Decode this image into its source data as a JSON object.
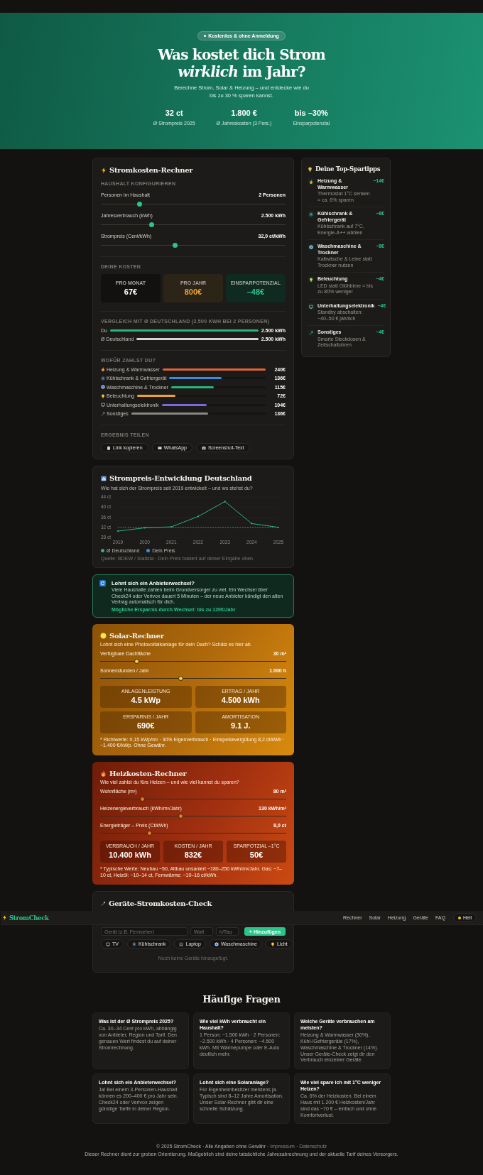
{
  "hero": {
    "badge": "Kostenlos & ohne Anmeldung",
    "title_line1": "Was kostet dich Strom",
    "title_line2": "*wirklich* im Jahr?",
    "subtitle": "Berechne Strom, Solar & Heizung – und entdecke wie du bis zu 30 % sparen kannst.",
    "stats": [
      {
        "value": "32 ct",
        "label": "Ø Strompreis 2025"
      },
      {
        "value": "1.800 €",
        "label": "Ø Jahreskosten (3 Pers.)"
      },
      {
        "value": "bis –30%",
        "label": "Einsparpotenzial"
      }
    ]
  },
  "calculator": {
    "title": "Stromkosten-Rechner",
    "section_label": "HAUSHALT KONFIGURIEREN",
    "sliders": [
      {
        "label": "Personen im Haushalt",
        "value": "2 Personen",
        "level": 0.2
      },
      {
        "label": "Jahresverbrauch (kWh)",
        "value": "2.500 kWh",
        "level": 0.27
      },
      {
        "label": "Strompreis (Cent/kWh)",
        "value": "32,0 ct/kWh",
        "level": 0.4
      }
    ],
    "costs_label": "DEINE KOSTEN",
    "costs": [
      {
        "label": "PRO MONAT",
        "value": "67€",
        "kind": "neutral"
      },
      {
        "label": "PRO JAHR",
        "value": "800€",
        "kind": "year"
      },
      {
        "label": "EINSPARPOTENZIAL",
        "value": "–48€",
        "kind": "saving"
      }
    ],
    "compare_label": "VERGLEICH MIT Ø DEUTSCHLAND (2.500 KWH BEI 2 PERSONEN)",
    "compare": [
      {
        "label": "Du",
        "value": "2.500 kWh",
        "level": 1,
        "color": "#2bb37f"
      },
      {
        "label": "Ø Deutschland",
        "value": "2.500 kWh",
        "level": 1,
        "color": "#d4d4d2"
      }
    ],
    "breakdown_label": "WOFÜR ZAHLST DU?",
    "breakdown": [
      {
        "kind": "heating",
        "label": "Heizung & Warmwasser",
        "value": "240€",
        "level": 1,
        "color": "#e0643a"
      },
      {
        "kind": "fridge",
        "label": "Kühlschrank & Gefriergerät",
        "value": "136€",
        "level": 0.54,
        "color": "#3b8be0"
      },
      {
        "kind": "washer",
        "label": "Waschmaschine & Trockner",
        "value": "115€",
        "level": 0.45,
        "color": "#2bb37f"
      },
      {
        "kind": "lighting",
        "label": "Beleuchtung",
        "value": "72€",
        "level": 0.3,
        "color": "#e8a33a"
      },
      {
        "kind": "electronics",
        "label": "Unterhaltungselektronik",
        "value": "104€",
        "level": 0.43,
        "color": "#7a6ae0"
      },
      {
        "kind": "other",
        "label": "Sonstiges",
        "value": "136€",
        "level": 0.57,
        "color": "#8a8883"
      }
    ],
    "share_label": "ERGEBNIS TEILEN",
    "share": [
      {
        "kind": "copy",
        "label": "Link kopieren"
      },
      {
        "kind": "whatsapp",
        "label": "WhatsApp"
      },
      {
        "kind": "screenshot",
        "label": "Screenshot-Text"
      }
    ]
  },
  "tips": {
    "title": "Deine Top-Spartipps",
    "items": [
      {
        "kind": "heating",
        "title": "Heizung & Warmwasser",
        "text": "Thermostat 1°C senken = ca. 6% sparen",
        "saving": "−14€"
      },
      {
        "kind": "fridge",
        "title": "Kühlschrank & Gefriergerät",
        "text": "Kühlschrank auf 7°C, Energie-A++ wählen",
        "saving": "−8€"
      },
      {
        "kind": "washer",
        "title": "Waschmaschine & Trockner",
        "text": "Kaltwäsche & Leine statt Trockner nutzen",
        "saving": "−8€"
      },
      {
        "kind": "lighting",
        "title": "Beleuchtung",
        "text": "LED statt Glühbirne = bis zu 80% weniger",
        "saving": "−4€"
      },
      {
        "kind": "electronics",
        "title": "Unterhaltungselektronik",
        "text": "Standby abschalten: ~40–50 € jährlich",
        "saving": "−4€"
      },
      {
        "kind": "other",
        "title": "Sonstiges",
        "text": "Smarte Steckdosen & Zeitschaltuhren",
        "saving": "−4€"
      }
    ]
  },
  "price_chart": {
    "title": "Strompreis-Entwicklung Deutschland",
    "subtitle": "Wie hat sich der Strompreis seit 2019 entwickelt – und wo stehst du?",
    "chart_data": {
      "type": "line",
      "categories": [
        "2019",
        "2020",
        "2021",
        "2022",
        "2023",
        "2024",
        "2025"
      ],
      "series": [
        {
          "name": "Ø Deutschland",
          "color": "#2bb37f",
          "values": [
            30.5,
            31.8,
            32.2,
            36.3,
            42.2,
            33.5,
            32.0
          ]
        },
        {
          "name": "Dein Preis",
          "color": "#3b8be0",
          "line_style": "dashed",
          "values": [
            32,
            32,
            32,
            32,
            32,
            32,
            32
          ]
        }
      ],
      "ylim": [
        28,
        44
      ],
      "yticks": [
        {
          "value": 28,
          "label": "28 ct"
        },
        {
          "value": 32,
          "label": "32 ct"
        },
        {
          "value": 36,
          "label": "36 ct"
        },
        {
          "value": 40,
          "label": "40 ct"
        },
        {
          "value": 44,
          "label": "44 ct"
        }
      ]
    },
    "source": "Quelle: BDEW / Statista · Dein Preis basiert auf deiner Eingabe oben."
  },
  "provider_switch": {
    "title": "Lohnt sich ein Anbieterwechsel?",
    "text": "Viele Haushalte zahlen beim Grundversorger zu viel. Ein Wechsel über Check24 oder Verivox dauert 5 Minuten – der neue Anbieter kündigt den alten Vertrag automatisch für dich.",
    "highlight": "Mögliche Ersparnis durch Wechsel: bis zu 120€/Jahr"
  },
  "solar": {
    "kind": "solar",
    "title": "Solar-Rechner",
    "subtitle": "Lohnt sich eine Photovoltaikanlage für dein Dach? Schätz es hier ab.",
    "sliders": [
      {
        "label": "Verfügbare Dachfläche",
        "value": "30 m²",
        "level": 0.19
      },
      {
        "label": "Sonnenstunden / Jahr",
        "value": "1.000 h",
        "level": 0.43
      }
    ],
    "tiles": [
      {
        "label": "ANLAGENLEISTUNG",
        "value": "4.5 kWp"
      },
      {
        "label": "ERTRAG / JAHR",
        "value": "4.500 kWh"
      },
      {
        "label": "ERSPARNIS / JAHR",
        "value": "690€"
      },
      {
        "label": "AMORTISATION",
        "value": "9.1 J."
      }
    ],
    "note": "* Richtwerte: 0,15 kWp/m² · 30% Eigenverbrauch · Einspeisevergütung 8,2 ct/kWh · ~1.400 €/kWp. Ohne Gewähr."
  },
  "heating": {
    "kind": "heating",
    "title": "Heizkosten-Rechner",
    "subtitle": "Wie viel zahlst du fürs Heizen – und wie viel kannst du sparen?",
    "sliders": [
      {
        "label": "Wohnfläche (m²)",
        "value": "80 m²",
        "level": 0.22
      },
      {
        "label": "Heizenergieverbrauch (kWh/m²/Jahr)",
        "value": "130 kWh/m²",
        "level": 0.43
      },
      {
        "label": "Energieträger – Preis (Ct/kWh)",
        "value": "8,0 ct",
        "level": 0.26
      }
    ],
    "tiles": [
      {
        "label": "VERBRAUCH / JAHR",
        "value": "10.400 kWh"
      },
      {
        "label": "KOSTEN / JAHR",
        "value": "832€"
      },
      {
        "label": "SPARPOTZIAL –1°C",
        "value": "50€"
      }
    ],
    "note": "* Typische Werte: Neubau ~50, Altbau unsaniert ~180–250 kWh/m²/Jahr. Gas: ~7–10 ct, Heizöl: ~10–14 ct, Fernwärme: ~10–16 ct/kWh."
  },
  "devices": {
    "title": "Geräte-Stromkosten-Check",
    "fields": [
      {
        "placeholder": "Gerät (z.B. Fernseher)"
      },
      {
        "placeholder": "Watt"
      },
      {
        "placeholder": "h/Tag"
      }
    ],
    "add_button": "+ Hinzufügen",
    "presets": [
      {
        "kind": "electronics",
        "label": "TV"
      },
      {
        "kind": "fridge",
        "label": "Kühlschrank"
      },
      {
        "kind": "laptop",
        "label": "Laptop"
      },
      {
        "kind": "washer",
        "label": "Waschmaschine"
      },
      {
        "kind": "lighting",
        "label": "Licht"
      }
    ],
    "empty": "Noch keine Geräte hinzugefügt."
  },
  "nav": {
    "logo": "StromCheck",
    "links": [
      "Rechner",
      "Solar",
      "Heizung",
      "Geräte",
      "FAQ"
    ],
    "theme_button": "Hell"
  },
  "faq": {
    "title": "Häufige Fragen",
    "items": [
      {
        "q": "Was ist der Ø Strompreis 2025?",
        "a": "Ca. 30–34 Cent pro kWh, abhängig von Anbieter, Region und Tarif. Den genauen Wert findest du auf deiner Stromrechnung."
      },
      {
        "q": "Wie viel kWh verbraucht ein Haushalt?",
        "a": "1 Person: ~1.500 kWh · 2 Personen: ~2.500 kWh · 4 Personen: ~4.500 kWh. Mit Wärmepumpe oder E-Auto deutlich mehr."
      },
      {
        "q": "Welche Geräte verbrauchen am meisten?",
        "a": "Heizung & Warmwasser (30%), Kühl-/Gefriergeräte (17%), Waschmaschine & Trockner (14%). Unser Geräte-Check zeigt dir den Verbrauch einzelner Geräte."
      },
      {
        "q": "Lohnt sich ein Anbieterwechsel?",
        "a": "Ja! Bei einem 3-Personen-Haushalt können es 200–400 € pro Jahr sein. Check24 oder Verivox zeigen günstige Tarife in deiner Region."
      },
      {
        "q": "Lohnt sich eine Solaranlage?",
        "a": "Für Eigenheimbesitzer meistens ja. Typisch sind 8–12 Jahre Amortisation. Unser Solar-Rechner gibt dir eine schnelle Schätzung."
      },
      {
        "q": "Wie viel spare ich mit 1°C weniger Heizen?",
        "a": "Ca. 6% der Heizkosten. Bei einem Haus mit 1.200 € Heizkosten/Jahr sind das ~70 € – einfach und ohne Komfortverlust."
      }
    ]
  },
  "footer": {
    "copyright": "© 2025 StromCheck · Alle Angaben ohne Gewähr ·",
    "links": [
      "Impressum",
      "Datenschutz"
    ],
    "separator": "·",
    "disclaimer": "Dieser Rechner dient zur groben Orientierung. Maßgeblich sind deine tatsächliche Jahresabrechnung und der aktuelle Tarif deines Versorgers."
  }
}
